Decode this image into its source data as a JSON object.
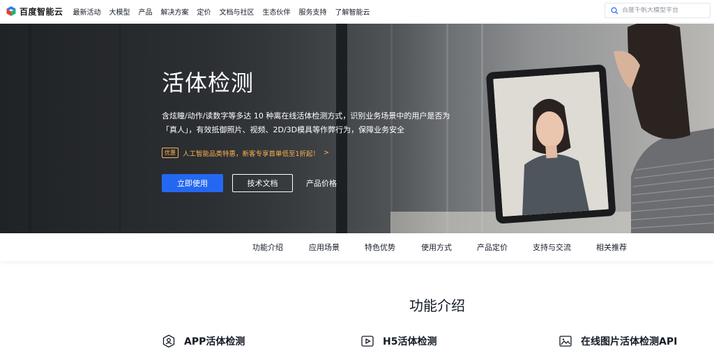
{
  "brand": {
    "name": "百度智能云"
  },
  "nav": {
    "items": [
      "最新活动",
      "大模型",
      "产品",
      "解决方案",
      "定价",
      "文档与社区",
      "生态伙伴",
      "服务支持",
      "了解智能云"
    ],
    "search_placeholder": "百度千帆大模型平台"
  },
  "hero": {
    "title": "活体检测",
    "desc_line1": "含炫瞳/动作/读数字等多达 10 种离在线活体检测方式，识别业务场景中的用户是否为",
    "desc_line2": "「真人」，有效抵御照片、视频、2D/3D模具等作弊行为，保障业务安全",
    "promo_badge": "优惠",
    "promo_text": "人工智能品类特惠，新客专享首单低至1折起！",
    "promo_arrow": ">",
    "primary_button": "立即使用",
    "secondary_button": "技术文档",
    "text_button": "产品价格"
  },
  "tabs": [
    "功能介绍",
    "应用场景",
    "特色优势",
    "使用方式",
    "产品定价",
    "支持与交流",
    "相关推荐"
  ],
  "features": {
    "section_title": "功能介绍",
    "items": [
      {
        "label": "APP活体检测",
        "icon": "user-shield-icon"
      },
      {
        "label": "H5活体检测",
        "icon": "video-play-icon"
      },
      {
        "label": "在线图片活体检测API",
        "icon": "image-icon"
      }
    ]
  },
  "colors": {
    "primary": "#2468f2",
    "promo": "#ffb04d",
    "text": "#151b26"
  }
}
